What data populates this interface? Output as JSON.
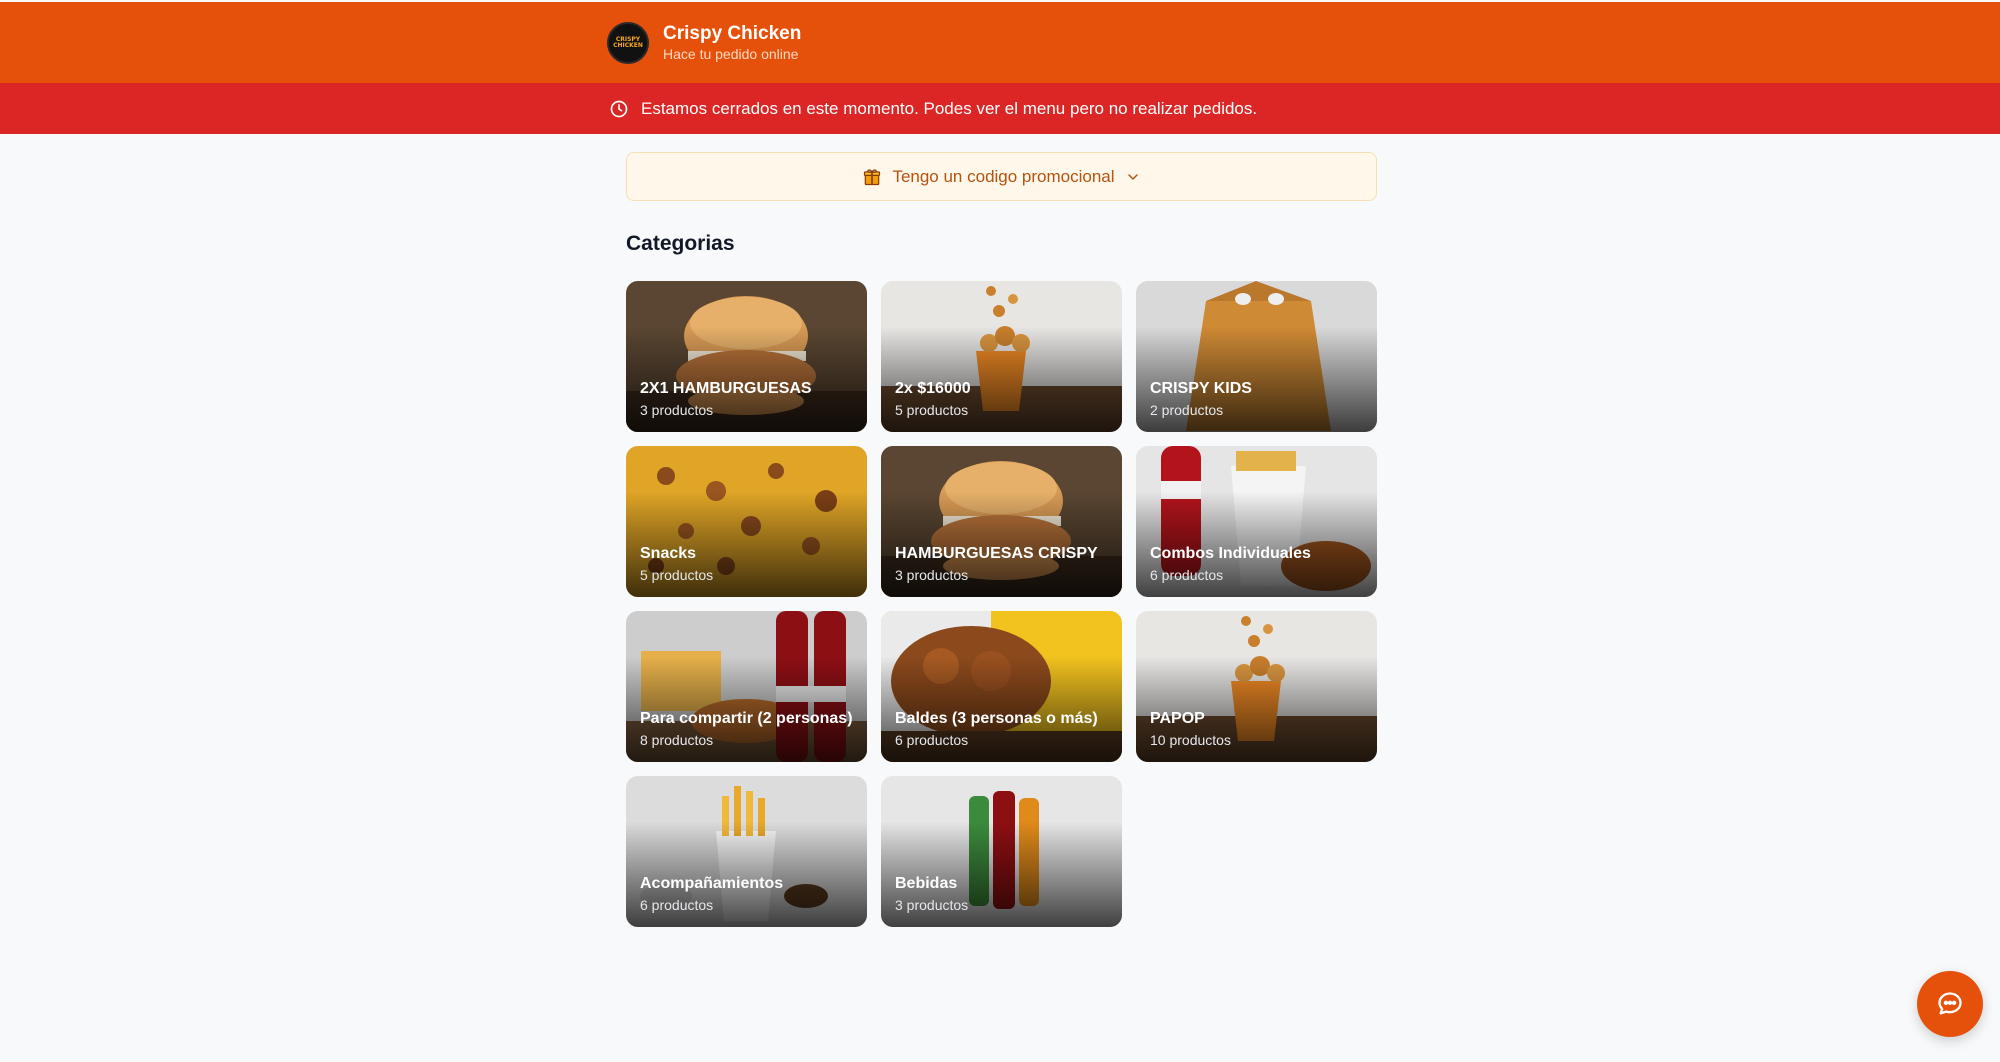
{
  "header": {
    "logo_text": "CRISPY CHICKEN",
    "title": "Crispy Chicken",
    "subtitle": "Hace tu pedido online",
    "color": "#e5510a"
  },
  "banner": {
    "icon": "clock-icon",
    "text": "Estamos cerrados en este momento. Podes ver el menu pero no realizar pedidos.",
    "color": "#dc2626"
  },
  "promo": {
    "icon": "gift-icon",
    "label": "Tengo un codigo promocional",
    "chevron": "chevron-down-icon"
  },
  "categories_title": "Categorias",
  "categories": [
    {
      "name": "2X1 HAMBURGUESAS",
      "count": "3 productos",
      "art": "burger"
    },
    {
      "name": "2x $16000",
      "count": "5 productos",
      "art": "popcorn"
    },
    {
      "name": "CRISPY KIDS",
      "count": "2 productos",
      "art": "box"
    },
    {
      "name": "Snacks",
      "count": "5 productos",
      "art": "snacks"
    },
    {
      "name": "HAMBURGUESAS CRISPY",
      "count": "3 productos",
      "art": "burger"
    },
    {
      "name": "Combos Individuales",
      "count": "6 productos",
      "art": "combo"
    },
    {
      "name": "Para compartir (2 personas)",
      "count": "8 productos",
      "art": "share"
    },
    {
      "name": "Baldes (3 personas o más)",
      "count": "6 productos",
      "art": "bucket"
    },
    {
      "name": "PAPOP",
      "count": "10 productos",
      "art": "popcorn"
    },
    {
      "name": "Acompañamientos",
      "count": "6 productos",
      "art": "fries"
    },
    {
      "name": "Bebidas",
      "count": "3 productos",
      "art": "drinks"
    }
  ],
  "chat": {
    "icon": "chat-bubble-icon"
  }
}
